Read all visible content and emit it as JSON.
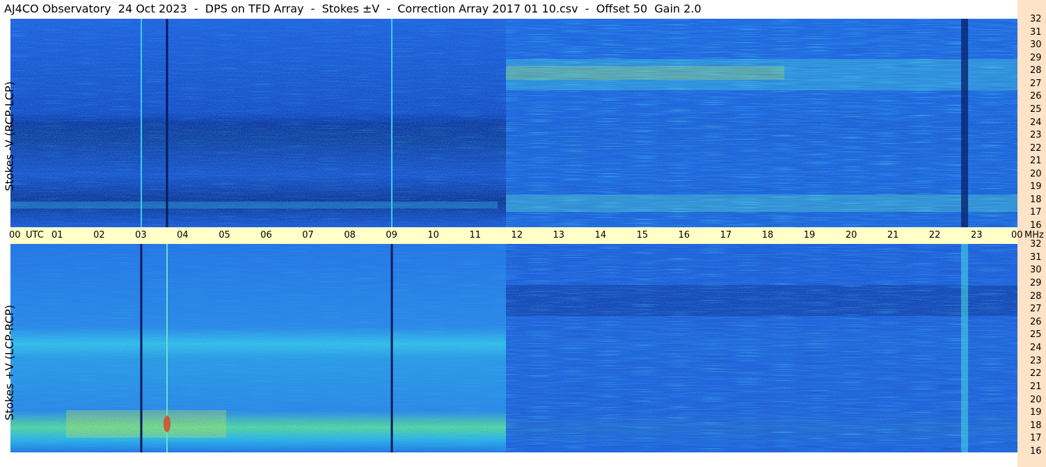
{
  "title": "AJ4CO Observatory  24 Oct 2023  -  DPS on TFD Array  -  Stokes ±V  -  Correction Array 2017 01 10.csv  -  Offset 50  Gain 2.0",
  "panels": [
    {
      "label": "Stokes -V (RCP-LCP)"
    },
    {
      "label": "Stokes +V (LCP-RCP)"
    }
  ],
  "colors": {
    "background_blue": "#1a5ce0",
    "dark_blue": "#0a2a8a",
    "cyan": "#2bd0f0",
    "yellow": "#e8f040",
    "red": "#d02020",
    "time_axis_bg": "#ffffc8",
    "freq_axis_bg": "#fde3c8"
  },
  "chart_data": {
    "type": "heatmap",
    "subtype": "dynamic spectrogram",
    "x_axis": {
      "ticks": [
        "00",
        "01",
        "02",
        "03",
        "04",
        "05",
        "06",
        "07",
        "08",
        "09",
        "10",
        "11",
        "12",
        "13",
        "14",
        "15",
        "16",
        "17",
        "18",
        "19",
        "20",
        "21",
        "22",
        "23",
        "00"
      ],
      "unit_label": "UTC",
      "range": [
        0,
        24
      ]
    },
    "y_axis": {
      "ticks": [
        32,
        31,
        30,
        29,
        28,
        27,
        26,
        25,
        24,
        23,
        22,
        21,
        20,
        19,
        18,
        17,
        16
      ],
      "unit_label": "MHz",
      "range": [
        16,
        32
      ]
    },
    "panels": 2,
    "features": {
      "vertical_lines_utc": [
        3.02,
        3.65,
        9.0,
        22.75
      ],
      "band_transition_utc": 11.75,
      "strong_bands_mhz": [
        27.5,
        17.8
      ]
    }
  }
}
